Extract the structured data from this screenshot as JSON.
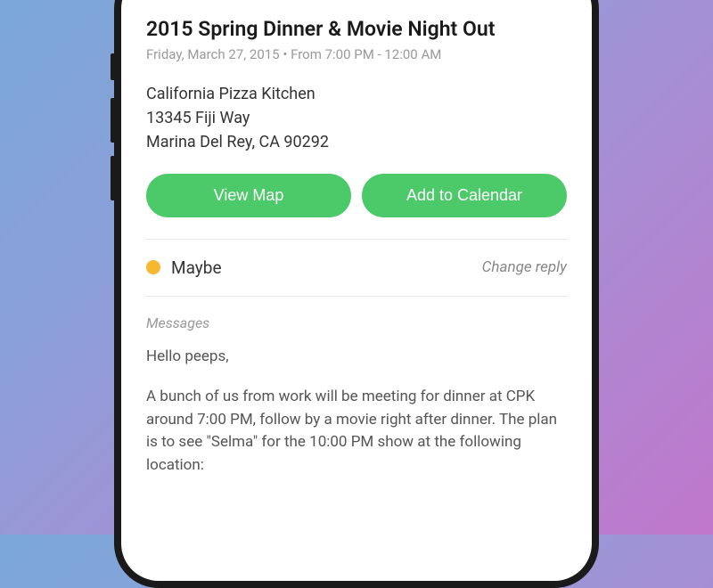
{
  "event": {
    "title": "2015 Spring Dinner & Movie Night Out",
    "datetime": "Friday, March 27, 2015 • From 7:00 PM - 12:00 AM"
  },
  "location": {
    "name": "California Pizza Kitchen",
    "street": "13345 Fiji Way",
    "city_state_zip": "Marina Del Rey, CA 90292"
  },
  "buttons": {
    "view_map": "View Map",
    "add_calendar": "Add to Calendar"
  },
  "rsvp": {
    "status": "Maybe",
    "status_color": "#F5B82E",
    "change_label": "Change reply"
  },
  "messages": {
    "header": "Messages",
    "greeting": "Hello peeps,",
    "body": "A bunch of us from work will be meeting for dinner at CPK around 7:00 PM, follow by a movie right after dinner. The plan is to see \"Selma\" for the 10:00 PM show at the following location:"
  },
  "colors": {
    "accent": "#4CC968"
  }
}
